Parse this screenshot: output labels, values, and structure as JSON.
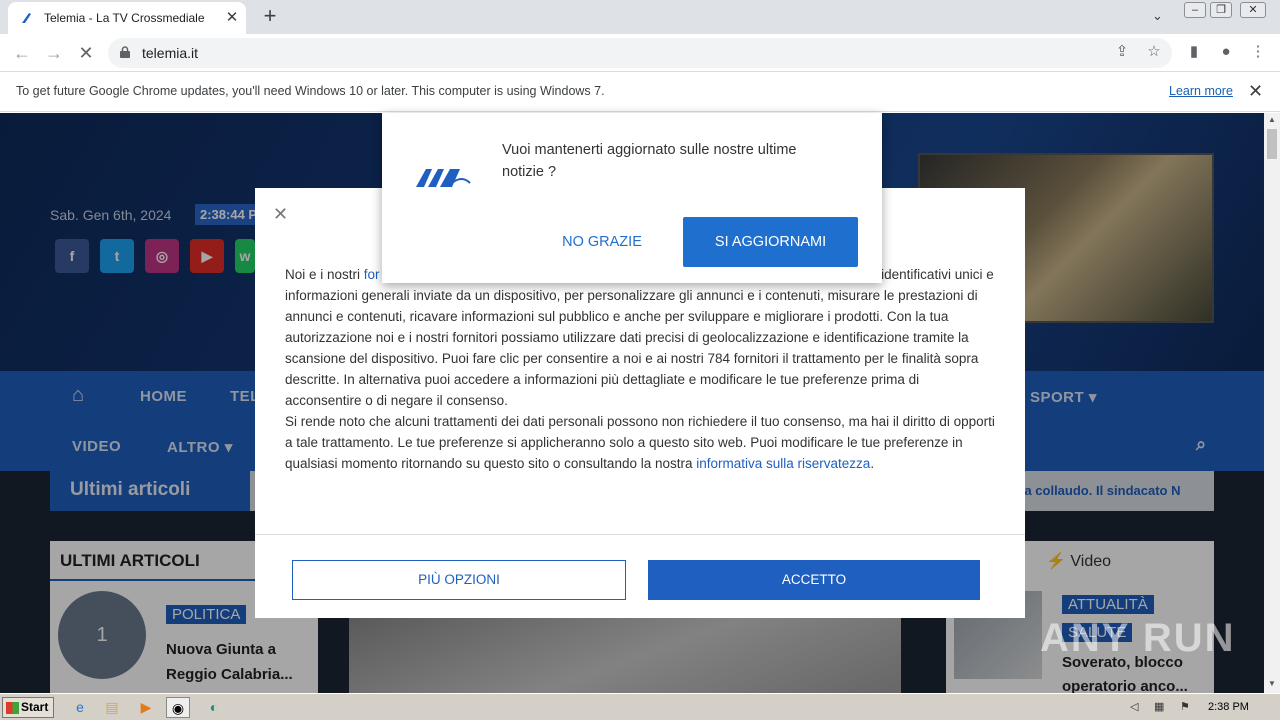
{
  "browser": {
    "tab_title": "Telemia - La TV Crossmediale",
    "url": "telemia.it",
    "infobar_message": "To get future Google Chrome updates, you'll need Windows 10 or later. This computer is using Windows 7.",
    "infobar_link": "Learn more"
  },
  "site": {
    "date": "Sab. Gen 6th, 2024",
    "clock": "2:38:44 P",
    "social": [
      "f",
      "t",
      "ig",
      "yt",
      "wa"
    ],
    "nav": [
      "HOME",
      "TEL",
      "SPORT",
      "VIDEO",
      "ALTRO"
    ],
    "ticker_label": "Ultimi articoli",
    "ticker_text": "nza collaudo. Il sindacato N",
    "left_header": "ULTIMI ARTICOLI",
    "left_thumb_number": "1",
    "left_badge": "POLITICA",
    "left_headline": "Nuova Giunta a Reggio Calabria...",
    "right_header": "Video",
    "right_badges": [
      "ATTUALITÀ",
      "SALUTE"
    ],
    "right_headline": "Soverato, blocco operatorio anco..."
  },
  "consent": {
    "title_fragment": "a",
    "body_p1_a": "Noi e i nostri ",
    "body_p1_link": "for",
    "body_p1_b": "e trattiamo i dati personali, quali gli identificativi unici e informazioni generali inviate da un dispositivo, per personalizzare gli annunci e i contenuti, misurare le prestazioni di annunci e contenuti, ricavare informazioni sul pubblico e anche per sviluppare e migliorare i prodotti. Con la tua autorizzazione noi e i nostri fornitori possiamo utilizzare dati precisi di geolocalizzazione e identificazione tramite la scansione del dispositivo. Puoi fare clic per consentire a noi e ai nostri 784 fornitori il trattamento per le finalità sopra descritte. In alternativa puoi accedere a informazioni più dettagliate e modificare le tue preferenze prima di acconsentire o di negare il consenso.",
    "body_p2": "Si rende noto che alcuni trattamenti dei dati personali possono non richiedere il tuo consenso, ma hai il diritto di opporti a tale trattamento. Le tue preferenze si applicheranno solo a questo sito web. Puoi modificare le tue preferenze in qualsiasi momento ritornando su questo sito o consultando la nostra ",
    "body_p2_link": "informativa sulla riservatezza",
    "body_p2_end": ".",
    "more_options": "PIÙ OPZIONI",
    "accept": "ACCETTO"
  },
  "push": {
    "question": "Vuoi mantenerti aggiornato sulle nostre ultime notizie ?",
    "no": "NO GRAZIE",
    "yes": "SI AGGIORNAMI"
  },
  "watermark": "ANY RUN",
  "taskbar": {
    "start": "Start",
    "time": "2:38 PM"
  },
  "colors": {
    "brand_blue": "#1f5fbf",
    "push_blue": "#1f6fcf"
  }
}
